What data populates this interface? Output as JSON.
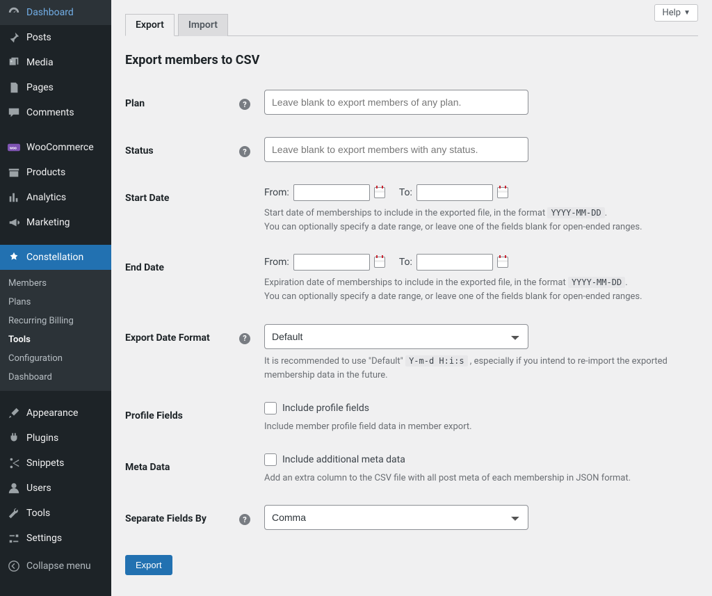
{
  "help_label": "Help",
  "sidebar": {
    "items": [
      {
        "label": "Dashboard",
        "icon": "dashboard"
      },
      {
        "label": "Posts",
        "icon": "pin"
      },
      {
        "label": "Media",
        "icon": "media"
      },
      {
        "label": "Pages",
        "icon": "pages"
      },
      {
        "label": "Comments",
        "icon": "comment"
      },
      {
        "label": "WooCommerce",
        "icon": "woo"
      },
      {
        "label": "Products",
        "icon": "archive"
      },
      {
        "label": "Analytics",
        "icon": "analytics"
      },
      {
        "label": "Marketing",
        "icon": "megaphone"
      },
      {
        "label": "Constellation",
        "icon": "constellation",
        "current": true
      },
      {
        "label": "Appearance",
        "icon": "brush"
      },
      {
        "label": "Plugins",
        "icon": "plug"
      },
      {
        "label": "Snippets",
        "icon": "scissors"
      },
      {
        "label": "Users",
        "icon": "user"
      },
      {
        "label": "Tools",
        "icon": "wrench"
      },
      {
        "label": "Settings",
        "icon": "sliders"
      }
    ],
    "submenu": [
      {
        "label": "Members"
      },
      {
        "label": "Plans"
      },
      {
        "label": "Recurring Billing"
      },
      {
        "label": "Tools",
        "current": true
      },
      {
        "label": "Configuration"
      },
      {
        "label": "Dashboard"
      }
    ],
    "collapse_label": "Collapse menu"
  },
  "tabs": {
    "export": "Export",
    "import": "Import"
  },
  "heading": "Export members to CSV",
  "labels": {
    "plan": "Plan",
    "status": "Status",
    "start_date": "Start Date",
    "end_date": "End Date",
    "from": "From:",
    "to": "To:",
    "export_date_format": "Export Date Format",
    "profile_fields": "Profile Fields",
    "meta_data": "Meta Data",
    "separate": "Separate Fields By"
  },
  "placeholders": {
    "plan": "Leave blank to export members of any plan.",
    "status": "Leave blank to export members with any status."
  },
  "descriptions": {
    "start1": "Start date of memberships to include in the exported file, in the format ",
    "start_code": "YYYY-MM-DD",
    "start2": ".",
    "start3": "You can optionally specify a date range, or leave one of the fields blank for open-ended ranges.",
    "end1": "Expiration date of memberships to include in the exported file, in the format ",
    "end_code": "YYYY-MM-DD",
    "end2": ".",
    "end3": "You can optionally specify a date range, or leave one of the fields blank for open-ended ranges.",
    "fmt1": "It is recommended to use \"Default\" ",
    "fmt_code": "Y-m-d H:i:s",
    "fmt2": " , especially if you intend to re-import the exported membership data in the future.",
    "profile_cb": "Include profile fields",
    "profile_desc": "Include member profile field data in member export.",
    "meta_cb": "Include additional meta data",
    "meta_desc": "Add an extra column to the CSV file with all post meta of each membership in JSON format."
  },
  "selects": {
    "date_format": {
      "options": [
        "Default"
      ],
      "value": "Default"
    },
    "separator": {
      "options": [
        "Comma"
      ],
      "value": "Comma"
    }
  },
  "submit_label": "Export"
}
